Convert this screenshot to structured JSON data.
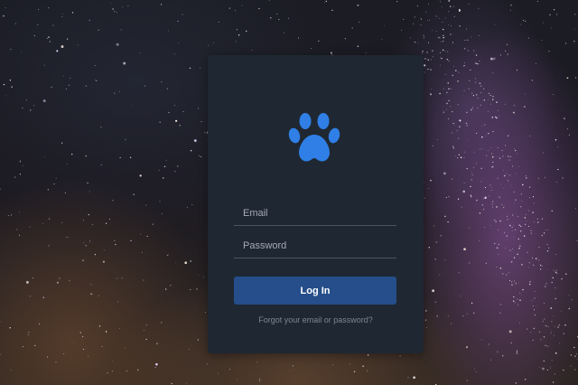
{
  "theme": {
    "card_color": "#1f2732",
    "accent_color": "#2f7fe6",
    "button_color": "#254e8a",
    "background": "starry-night-milky-way"
  },
  "logo": {
    "icon": "paw-icon"
  },
  "form": {
    "email_placeholder": "Email",
    "email_value": "",
    "password_placeholder": "Password",
    "password_value": "",
    "login_label": "Log In",
    "forgot_label": "Forgot your email or password?"
  }
}
